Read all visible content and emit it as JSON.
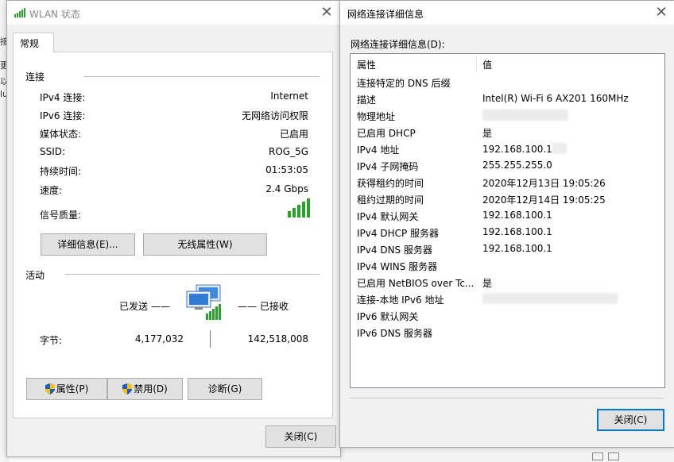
{
  "background": {
    "strip_glyphs": [
      "接",
      "更",
      "以",
      "lu"
    ]
  },
  "wlan_window": {
    "title": "WLAN 状态",
    "tab": "常规",
    "connection_section": "连接",
    "fields": [
      {
        "label": "IPv4 连接:",
        "value": "Internet"
      },
      {
        "label": "IPv6 连接:",
        "value": "无网络访问权限"
      },
      {
        "label": "媒体状态:",
        "value": "已启用"
      },
      {
        "label": "SSID:",
        "value": "ROG_5G"
      },
      {
        "label": "持续时间:",
        "value": "01:53:05"
      },
      {
        "label": "速度:",
        "value": "2.4 Gbps"
      }
    ],
    "signal_label": "信号质量:",
    "signal_bars": 5,
    "details_button": "详细信息(E)...",
    "wireless_props_button": "无线属性(W)",
    "activity_section": "活动",
    "sent_label": "已发送 ——",
    "received_label": "—— 已接收",
    "bytes_label": "字节:",
    "bytes_sent": "4,177,032",
    "bytes_received": "142,518,008",
    "properties_button": "属性(P)",
    "disable_button": "禁用(D)",
    "diagnose_button": "诊断(G)",
    "close_button": "关闭(C)"
  },
  "details_window": {
    "title": "网络连接详细信息",
    "caption": "网络连接详细信息(D):",
    "columns": [
      "属性",
      "值"
    ],
    "rows": [
      {
        "prop": "连接特定的 DNS 后缀",
        "value": ""
      },
      {
        "prop": "描述",
        "value": "Intel(R) Wi-Fi 6 AX201 160MHz"
      },
      {
        "prop": "物理地址",
        "value": "",
        "redacted": true
      },
      {
        "prop": "已启用 DHCP",
        "value": "是"
      },
      {
        "prop": "IPv4 地址",
        "value": "192.168.100.1",
        "redacted": true
      },
      {
        "prop": "IPv4 子网掩码",
        "value": "255.255.255.0"
      },
      {
        "prop": "获得租约的时间",
        "value": "2020年12月13日 19:05:26"
      },
      {
        "prop": "租约过期的时间",
        "value": "2020年12月14日 19:05:25"
      },
      {
        "prop": "IPv4 默认网关",
        "value": "192.168.100.1"
      },
      {
        "prop": "IPv4 DHCP 服务器",
        "value": "192.168.100.1"
      },
      {
        "prop": "IPv4 DNS 服务器",
        "value": "192.168.100.1"
      },
      {
        "prop": "IPv4 WINS 服务器",
        "value": ""
      },
      {
        "prop": "已启用 NetBIOS over Tc...",
        "value": "是"
      },
      {
        "prop": "连接-本地 IPv6 地址",
        "value": "",
        "redacted": true
      },
      {
        "prop": "IPv6 默认网关",
        "value": ""
      },
      {
        "prop": "IPv6 DNS 服务器",
        "value": ""
      }
    ],
    "close_button": "关闭(C)"
  },
  "colors": {
    "signal_green": "#2aa12a",
    "focus_blue": "#0078d7",
    "shield_blue": "#1e5bc6",
    "shield_yellow": "#f5c400"
  }
}
